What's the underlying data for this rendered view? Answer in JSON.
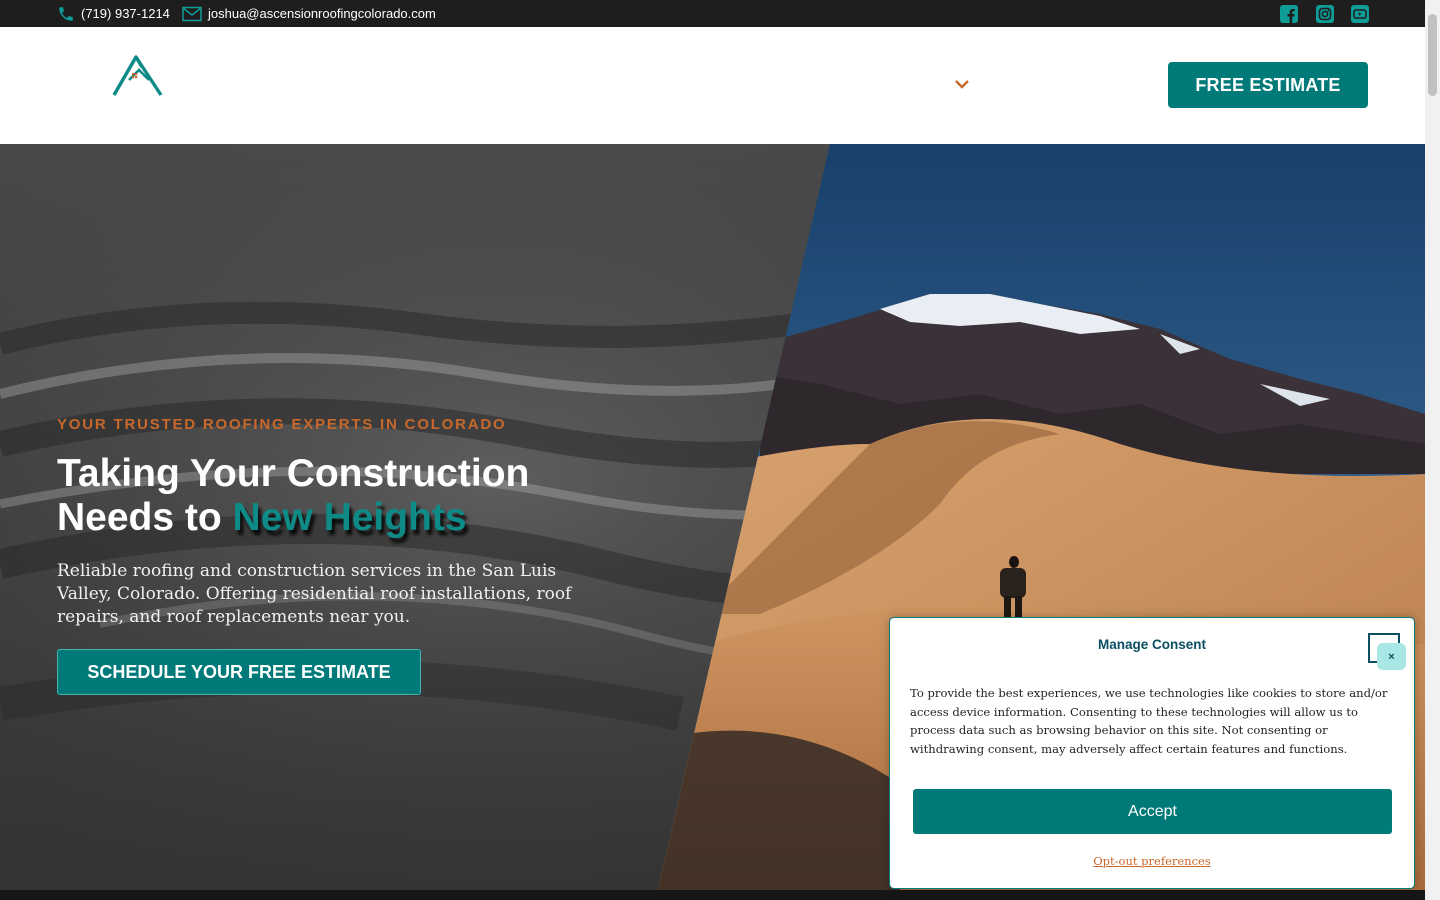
{
  "topbar": {
    "phone": "(719) 937-1214",
    "email": "joshua@ascensionroofingcolorado.com",
    "icons": {
      "phone": "phone-icon",
      "email": "envelope-icon",
      "social": [
        "facebook-icon",
        "instagram-icon",
        "youtube-icon"
      ]
    }
  },
  "header": {
    "cta_label": "FREE ESTIMATE",
    "nav_dropdown_icon": "chevron-down-icon"
  },
  "hero": {
    "eyebrow": "YOUR TRUSTED ROOFING EXPERTS IN COLORADO",
    "headline_part1": "Taking Your Construction",
    "headline_part2": "Needs to ",
    "headline_accent": "New Heights",
    "lead": "Reliable roofing and construction services in the San Luis Valley, Colorado. Offering residential roof installations, roof repairs, and roof replacements near you.",
    "cta_label": "SCHEDULE YOUR FREE ESTIMATE"
  },
  "consent": {
    "title": "Manage Consent",
    "close_label": "×",
    "text": "To provide the best experiences, we use technologies like cookies to store and/or access device information. Consenting to these technologies will allow us to process data such as browsing behavior on this site. Not consenting or withdrawing consent, may adversely affect certain features and functions.",
    "accept_label": "Accept",
    "optout_label": "Opt-out preferences"
  },
  "colors": {
    "brand_teal": "#007a78",
    "accent_orange": "#c8682b",
    "topbar_bg": "#1e1e1e",
    "consent_title": "#0b4f62"
  }
}
